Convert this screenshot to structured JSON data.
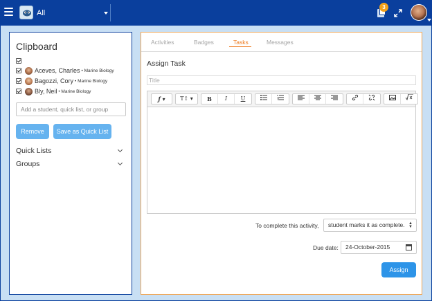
{
  "topbar": {
    "scope": "All",
    "notification_count": "3",
    "icons": [
      "hamburger-icon",
      "app-logo-icon",
      "notifications-icon",
      "expand-icon",
      "user-avatar"
    ]
  },
  "clipboard": {
    "title": "Clipboard",
    "students": [
      {
        "name": "Aceves, Charles",
        "course": "• Marine Biology",
        "checked": true
      },
      {
        "name": "Bagozzi, Cory",
        "course": "• Marine Biology",
        "checked": true
      },
      {
        "name": "Bly, Neil",
        "course": "• Marine Biology",
        "checked": true
      }
    ],
    "add_placeholder": "Add a student, quick list, or group",
    "remove_label": "Remove",
    "save_label": "Save as Quick List",
    "quick_lists_label": "Quick Lists",
    "groups_label": "Groups"
  },
  "task": {
    "tabs": [
      "Activities",
      "Badges",
      "Tasks",
      "Messages"
    ],
    "active_tab": "Tasks",
    "heading": "Assign Task",
    "title_placeholder": "Title",
    "toolbar": {
      "font": "ƒ",
      "size": "T↕",
      "bold": "B",
      "italic": "I",
      "underline": "U"
    },
    "complete_label": "To complete this activity,",
    "complete_value": "student marks it as complete.",
    "due_label": "Due date:",
    "due_value": "24-October-2015",
    "assign_label": "Assign"
  },
  "colors": {
    "topbar": "#0a3f9d",
    "background": "#c8dff4",
    "accent_orange": "#ee7c22",
    "button_blue": "#66b3ef",
    "assign_blue": "#2d94e8",
    "badge": "#f4a21b"
  }
}
